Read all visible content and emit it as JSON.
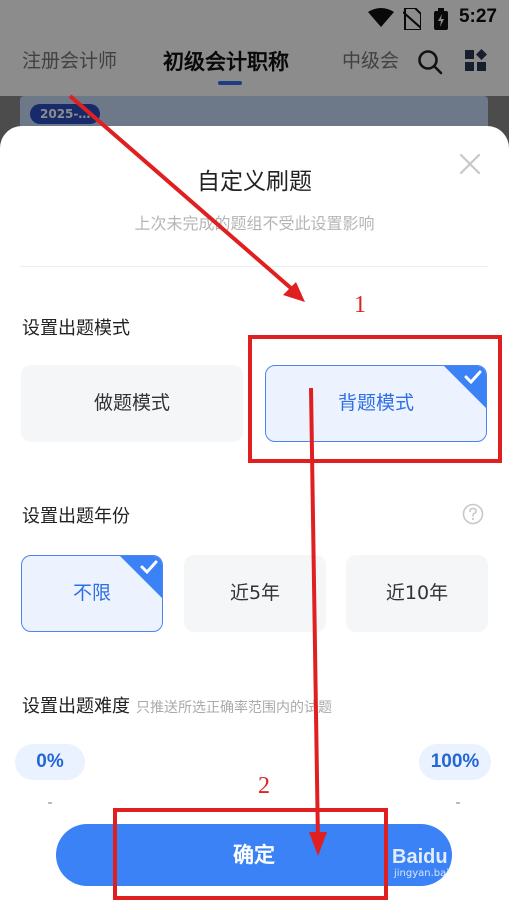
{
  "status_bar": {
    "time": "5:27"
  },
  "top_tabs": {
    "items": [
      "注册会计师",
      "初级会计职称",
      "中级会"
    ],
    "active_index": 1
  },
  "banner": {
    "badge": "2025-…"
  },
  "modal": {
    "title": "自定义刷题",
    "subtitle": "上次未完成的题组不受此设置影响",
    "mode_section": {
      "label": "设置出题模式",
      "options": [
        "做题模式",
        "背题模式"
      ],
      "selected_index": 1
    },
    "year_section": {
      "label": "设置出题年份",
      "options": [
        "不限",
        "近5年",
        "近10年"
      ],
      "selected_index": 0
    },
    "difficulty_section": {
      "label": "设置出题难度",
      "hint": "只推送所选正确率范围内的试题",
      "min_label": "0%",
      "max_label": "100%"
    },
    "confirm_label": "确定"
  },
  "annotations": {
    "label_1": "1",
    "label_2": "2",
    "color": "#e02020"
  },
  "watermark": {
    "brand": "Baidu 经验",
    "sub": "jingyan.baidu.com"
  },
  "colors": {
    "accent": "#3b82f6",
    "selected_border": "#4a86ee",
    "selected_bg": "#ecf3fe"
  }
}
